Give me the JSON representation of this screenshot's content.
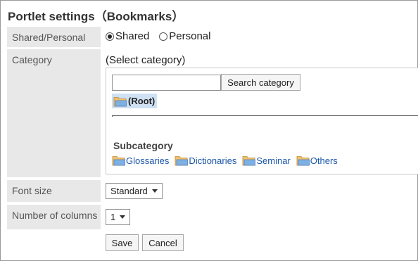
{
  "page": {
    "title": "Portlet settings（Bookmarks）"
  },
  "shared_personal": {
    "label": "Shared/Personal",
    "options": [
      {
        "label": "Shared",
        "selected": true
      },
      {
        "label": "Personal",
        "selected": false
      }
    ]
  },
  "category": {
    "label": "Category",
    "heading": "(Select category)",
    "search_value": "",
    "search_button": "Search category",
    "root_label": "(Root)",
    "subcategory_title": "Subcategory",
    "subcategories": [
      "Glossaries",
      "Dictionaries",
      "Seminar",
      "Others"
    ]
  },
  "font_size": {
    "label": "Font size",
    "selected": "Standard"
  },
  "columns": {
    "label": "Number of columns",
    "selected": "1"
  },
  "actions": {
    "save": "Save",
    "cancel": "Cancel"
  },
  "colors": {
    "label_bg": "#e8e8e8",
    "link": "#1a55a8",
    "root_highlight": "#cfe0f3",
    "folder": "#f0c070"
  },
  "icons": {
    "folder": "folder-icon",
    "caret": "chevron-down-icon"
  }
}
